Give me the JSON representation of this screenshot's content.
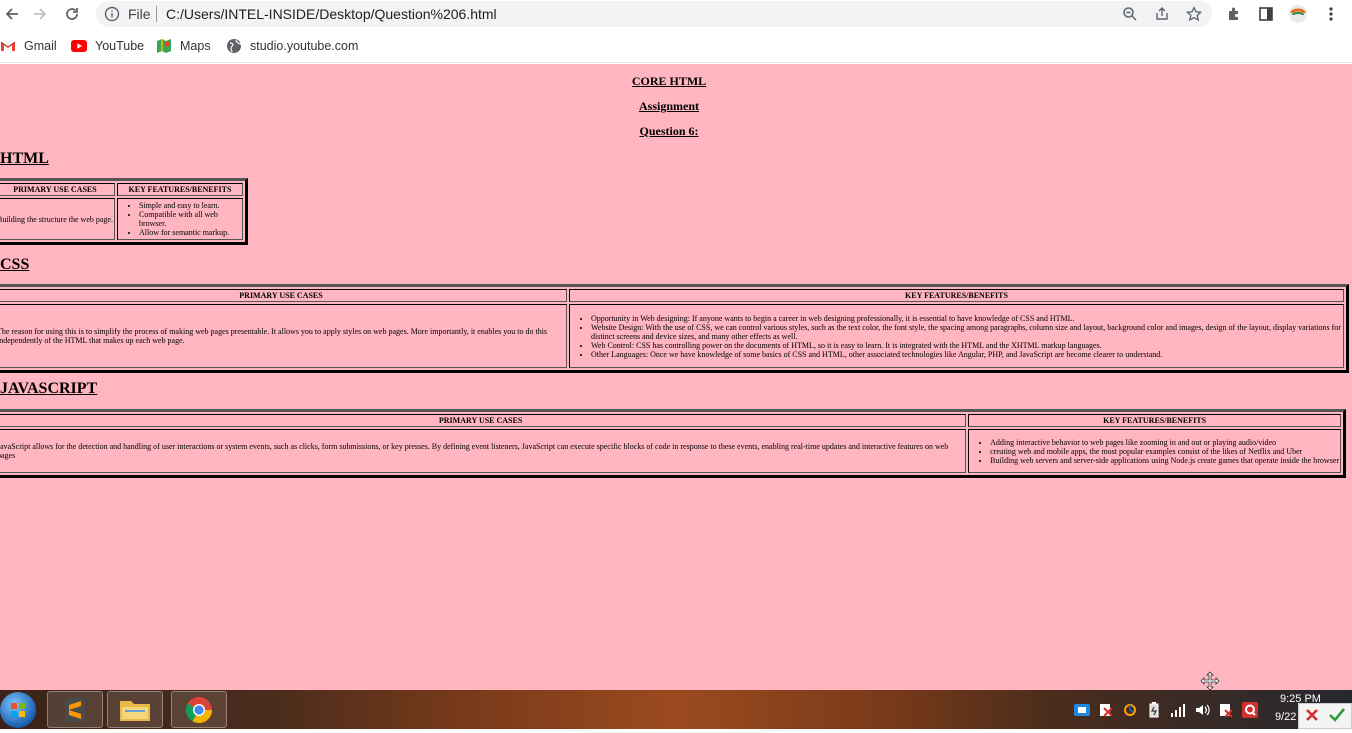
{
  "browser": {
    "scheme_label": "File",
    "url": "C:/Users/INTEL-INSIDE/Desktop/Question%206.html",
    "bookmarks": [
      {
        "label": "Gmail",
        "icon": "gmail-icon"
      },
      {
        "label": "YouTube",
        "icon": "youtube-icon"
      },
      {
        "label": "Maps",
        "icon": "maps-icon"
      },
      {
        "label": "studio.youtube.com",
        "icon": "globe-icon"
      }
    ]
  },
  "page": {
    "background": "#ffb6c1",
    "titles": [
      "CORE HTML",
      "Assignment",
      "Question 6:"
    ],
    "sections": [
      {
        "heading": "HTML",
        "headers": [
          "PRIMARY USE CASES",
          "KEY FEATURES/BENEFITS"
        ],
        "use_case": "Building the structure the web page.",
        "features": [
          "Simple and easy to learn.",
          "Compatible with all web browser.",
          "Allow for semantic markup."
        ]
      },
      {
        "heading": "CSS",
        "headers": [
          "PRIMARY USE CASES",
          "KEY FEATURES/BENEFITS"
        ],
        "use_case": "The reason for using this is to simplify the process of making web pages presentable. It allows you to apply styles on web pages. More importantly, it enables you to do this independently of the HTML that makes up each web page.",
        "features": [
          "Opportunity in Web designing: If anyone wants to begin a career in web designing professionally, it is essential to have knowledge of CSS and HTML.",
          "Website Design: With the use of CSS, we can control various styles, such as the text color, the font style, the spacing among paragraphs, column size and layout, background color and images, design of the layout, display variations for distinct screens and device sizes, and many other effects as well.",
          "Web Control: CSS has controlling power on the documents of HTML, so it is easy to learn. It is integrated with the HTML and the XHTML markup languages.",
          "Other Languages: Once we have knowledge of some basics of CSS and HTML, other associated technologies like Angular, PHP, and JavaScript are become clearer to understand."
        ]
      },
      {
        "heading": "JAVASCRIPT",
        "headers": [
          "PRIMARY USE CASES",
          "KEY FEATURES/BENEFITS"
        ],
        "use_case": "JavaScript allows for the detection and handling of user interactions or system events, such as clicks, form submissions, or key presses. By defining event listeners, JavaScript can execute specific blocks of code in response to these events, enabling real-time updates and interactive features on web pages",
        "features": [
          "Adding interactive behavior to web pages like zooming in and out or playing audio/video",
          "creating web and mobile apps, the most popular examples consist of the likes of Netflix and Uber",
          "Building web servers and server-side applications using Node.js create games that operate inside the browser"
        ]
      }
    ]
  },
  "taskbar": {
    "apps": [
      "start-button",
      "sublime-text",
      "file-explorer",
      "google-chrome"
    ],
    "clock_time": "9:25 PM",
    "clock_date": "9/22"
  }
}
